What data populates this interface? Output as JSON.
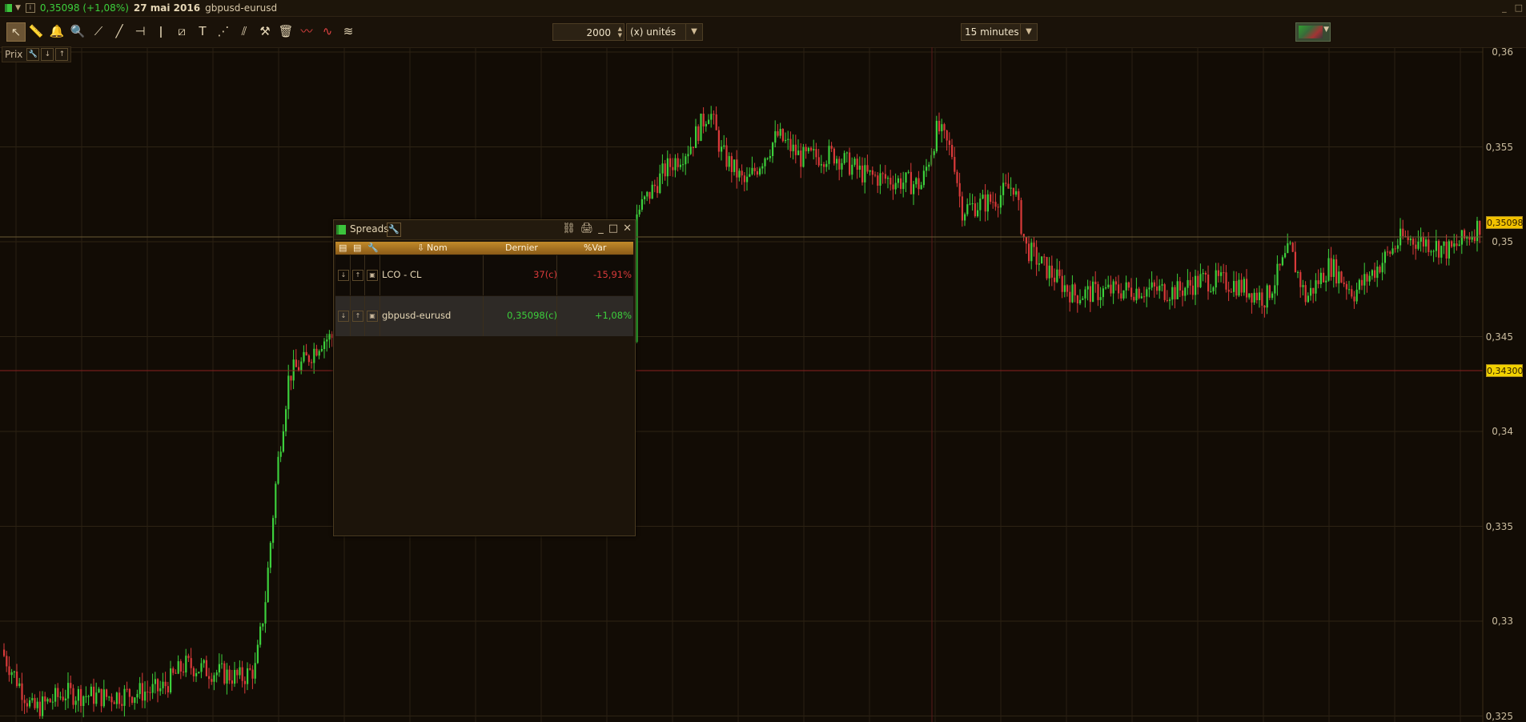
{
  "title": {
    "price": "0,35098 (+1,08%)",
    "date": "27 mai 2016",
    "symbol": "gbpusd-eurusd",
    "window_buttons": [
      "_",
      "□"
    ]
  },
  "toolbar": {
    "quantity": "2000",
    "units": "(x) unités",
    "timeframe": "15 minutes"
  },
  "panel": {
    "label": "Prix"
  },
  "axis": {
    "ticks": [
      "0,36",
      "0,355",
      "0,35",
      "0,345",
      "0,34",
      "0,335",
      "0,33",
      "0,325"
    ],
    "last_price_tag": "0,35098",
    "cursor_price_tag": "0,34300"
  },
  "spreads": {
    "title": "Spreads",
    "columns": [
      "Nom",
      "Dernier",
      "%Var"
    ],
    "rows": [
      {
        "name": "LCO - CL",
        "last": "37(c)",
        "var": "-15,91%"
      },
      {
        "name": "gbpusd-eurusd",
        "last": "0,35098(c)",
        "var": "+1,08%"
      }
    ]
  },
  "colors": {
    "up": "#3ccf3c",
    "down": "#d93a3a",
    "background": "#120c05",
    "tag_last": "#f2c200",
    "tag_cursor": "#f2d200"
  },
  "icons": [
    "pointer-icon",
    "ruler-icon",
    "alert-icon",
    "zoom-icon",
    "line-icon",
    "ray-icon",
    "horizontal-line-icon",
    "vertical-line-icon",
    "fibonacci-icon",
    "text-icon",
    "channel-icon",
    "pitchfork-icon",
    "tools-icon",
    "trash-icon",
    "indicator-icon",
    "oscillator-icon",
    "levels-icon"
  ]
}
